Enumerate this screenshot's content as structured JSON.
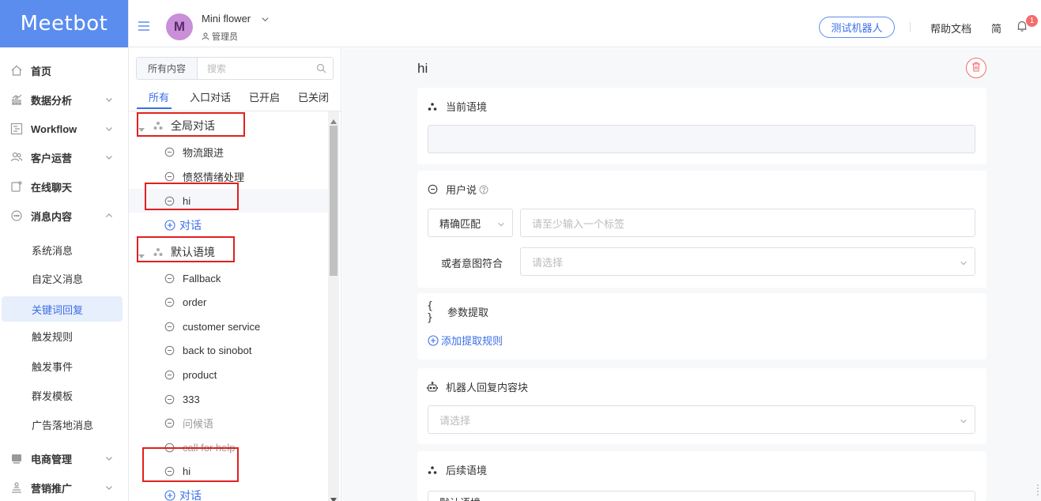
{
  "app": {
    "logo_text": "Meetbot"
  },
  "colors": {
    "accent": "#3a6ee8",
    "logo_bg": "#5b8def",
    "danger": "#f56c6c",
    "highlight_box": "#e02020"
  },
  "sidebar": {
    "items": [
      {
        "label": "首页",
        "icon": "home-icon"
      },
      {
        "label": "数据分析",
        "icon": "chart-icon"
      },
      {
        "label": "Workflow",
        "icon": "workflow-icon"
      },
      {
        "label": "客户运营",
        "icon": "users-icon"
      },
      {
        "label": "在线聊天",
        "icon": "chat-icon"
      },
      {
        "label": "消息内容",
        "icon": "message-icon"
      }
    ],
    "sub_items": [
      {
        "label": "系统消息"
      },
      {
        "label": "自定义消息"
      },
      {
        "label": "关键词回复"
      },
      {
        "label": "触发规则"
      },
      {
        "label": "触发事件"
      },
      {
        "label": "群发模板"
      },
      {
        "label": "广告落地消息"
      }
    ],
    "bottom_items": [
      {
        "label": "电商管理",
        "icon": "shop-icon"
      },
      {
        "label": "营销推广",
        "icon": "marketing-icon"
      }
    ]
  },
  "header": {
    "avatar_letter": "M",
    "account_name": "Mini flower",
    "account_role": "管理员",
    "test_bot": "测试机器人",
    "help": "帮助文档",
    "lang": "简",
    "notification_count": "1"
  },
  "tree_panel": {
    "search_scope": "所有内容",
    "search_placeholder": "搜索",
    "tabs": [
      "所有",
      "入口对话",
      "已开启",
      "已关闭"
    ],
    "groups": [
      {
        "label": "全局对话",
        "items": [
          "物流跟进",
          "愤怒情绪处理",
          "hi"
        ],
        "add_label": "对话"
      },
      {
        "label": "默认语境",
        "items": [
          "Fallback",
          "order",
          "customer service",
          "back to sinobot",
          "product",
          "333",
          "问候语",
          "call for help",
          "hi"
        ],
        "add_label": "对话"
      }
    ]
  },
  "editor": {
    "title": "hi",
    "current_context": {
      "label": "当前语境",
      "value": ""
    },
    "user_says": {
      "label": "用户说",
      "match_type": "精确匹配",
      "tag_placeholder": "请至少输入一个标签",
      "intent_label": "或者意图符合",
      "intent_placeholder": "请选择"
    },
    "params": {
      "label": "参数提取",
      "add_label": "添加提取规则"
    },
    "bot_reply": {
      "label": "机器人回复内容块",
      "placeholder": "请选择"
    },
    "next_context": {
      "label": "后续语境",
      "value": "默认语境"
    }
  }
}
